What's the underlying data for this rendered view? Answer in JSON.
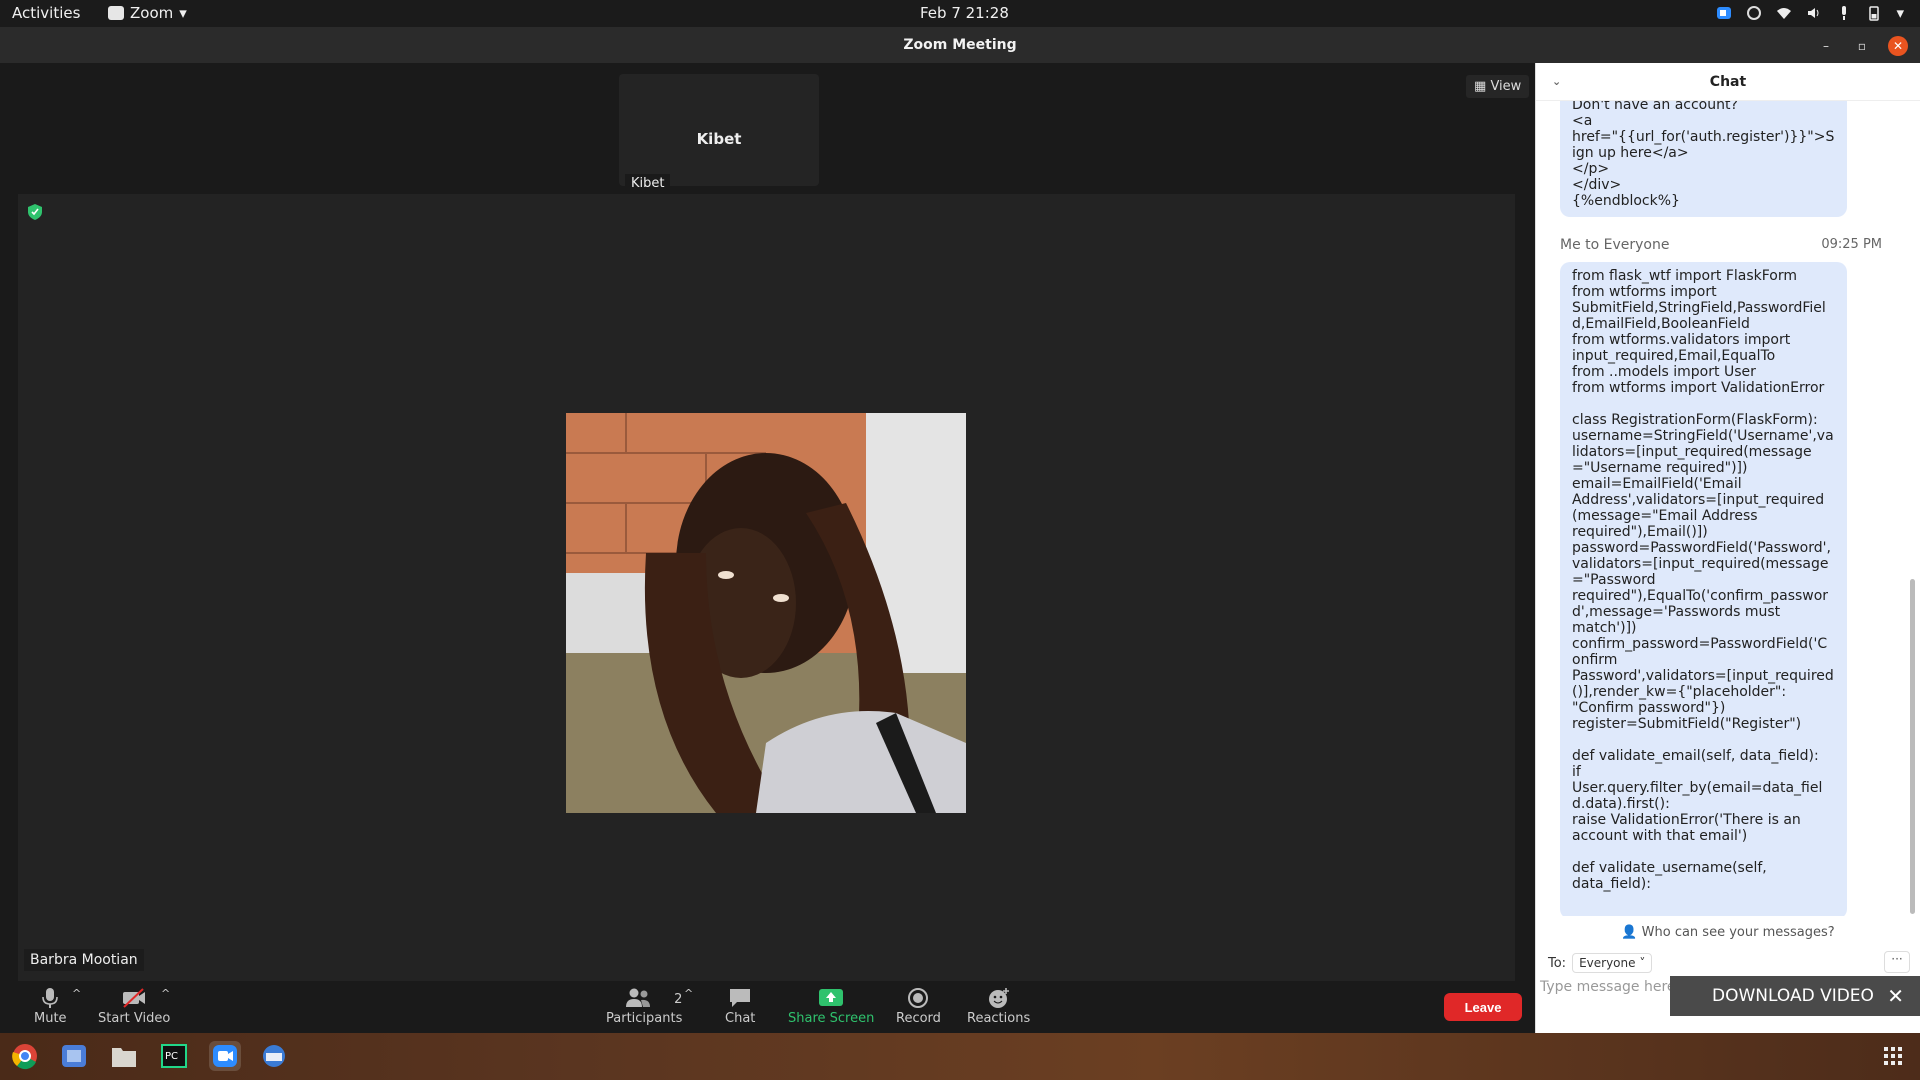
{
  "topbar": {
    "activities": "Activities",
    "app": "Zoom",
    "clock": "Feb 7  21:28"
  },
  "window": {
    "title": "Zoom Meeting"
  },
  "meeting": {
    "thumbnail": {
      "name": "Kibet",
      "label": "Kibet"
    },
    "view_label": "View",
    "speaker_label": "Barbra Mootian"
  },
  "toolbar": {
    "mute": "Mute",
    "start_video": "Start Video",
    "participants": "Participants",
    "participants_count": "2",
    "chat": "Chat",
    "share": "Share Screen",
    "record": "Record",
    "reactions": "Reactions",
    "leave": "Leave"
  },
  "chat": {
    "title": "Chat",
    "prev_message": "Don't have an account?\n<a\nhref=\"{{url_for('auth.register')}}\">Sign up here</a>\n</p>\n</div>\n{%endblock%}",
    "sender": "Me to Everyone",
    "time": "09:25 PM",
    "message": "from flask_wtf import FlaskForm\nfrom wtforms import\nSubmitField,StringField,PasswordField,EmailField,BooleanField\nfrom wtforms.validators import\ninput_required,Email,EqualTo\nfrom ..models import User\nfrom wtforms import ValidationError\n\nclass RegistrationForm(FlaskForm):\nusername=StringField('Username',validators=[input_required(message=\"Username required\")])\nemail=EmailField('Email\nAddress',validators=[input_required(message=\"Email Address\nrequired\"),Email()])\npassword=PasswordField('Password',\nvalidators=[input_required(message=\"Password\nrequired\"),EqualTo('confirm_password',message='Passwords must\nmatch')])\nconfirm_password=PasswordField('Confirm\nPassword',validators=[input_required()],render_kw={\"placeholder\":\n\"Confirm password\"})\nregister=SubmitField(\"Register\")\n\ndef validate_email(self, data_field):\nif\nUser.query.filter_by(email=data_field.data).first():\nraise ValidationError('There is an\naccount with that email')\n\ndef validate_username(self,\ndata_field):",
    "who_can_see": "Who can see your messages?",
    "to_label": "To:",
    "to_value": "Everyone",
    "more": "···",
    "input_placeholder": "Type message here..."
  },
  "overlay": {
    "download": "DOWNLOAD VIDEO",
    "close": "✕"
  },
  "colors": {
    "accent_green": "#2fc26d",
    "leave_red": "#e02828",
    "close_orange": "#e95420",
    "chat_bubble": "#dfe9fb"
  }
}
